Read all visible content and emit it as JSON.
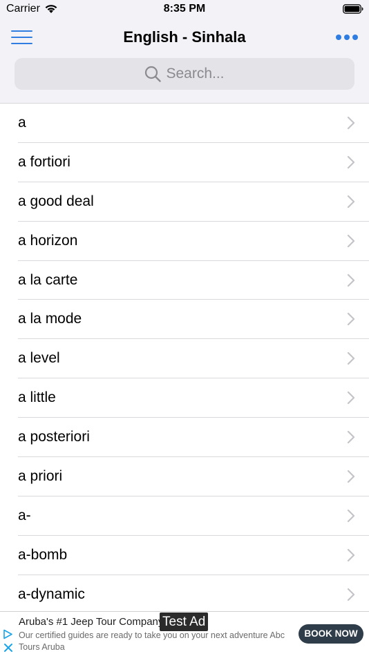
{
  "status_bar": {
    "carrier": "Carrier",
    "time": "8:35 PM"
  },
  "nav": {
    "title": "English - Sinhala"
  },
  "search": {
    "placeholder": "Search..."
  },
  "words": [
    {
      "label": "a"
    },
    {
      "label": "a fortiori"
    },
    {
      "label": "a good deal"
    },
    {
      "label": "a horizon"
    },
    {
      "label": "a la carte"
    },
    {
      "label": "a la mode"
    },
    {
      "label": "a level"
    },
    {
      "label": "a little"
    },
    {
      "label": "a posteriori"
    },
    {
      "label": "a priori"
    },
    {
      "label": "a-"
    },
    {
      "label": "a-bomb"
    },
    {
      "label": "a-dynamic"
    }
  ],
  "ad": {
    "title": "Aruba's #1 Jeep Tour Company",
    "badge": "Test Ad",
    "description": "Our certified guides are ready to take you on your next adventure Abc Tours Aruba",
    "cta": "BOOK NOW"
  },
  "colors": {
    "accent": "#2f7de1",
    "nav_bg": "#f2f2f7",
    "search_bg": "#e3e3e8",
    "cta_bg": "#2f3d4a"
  }
}
